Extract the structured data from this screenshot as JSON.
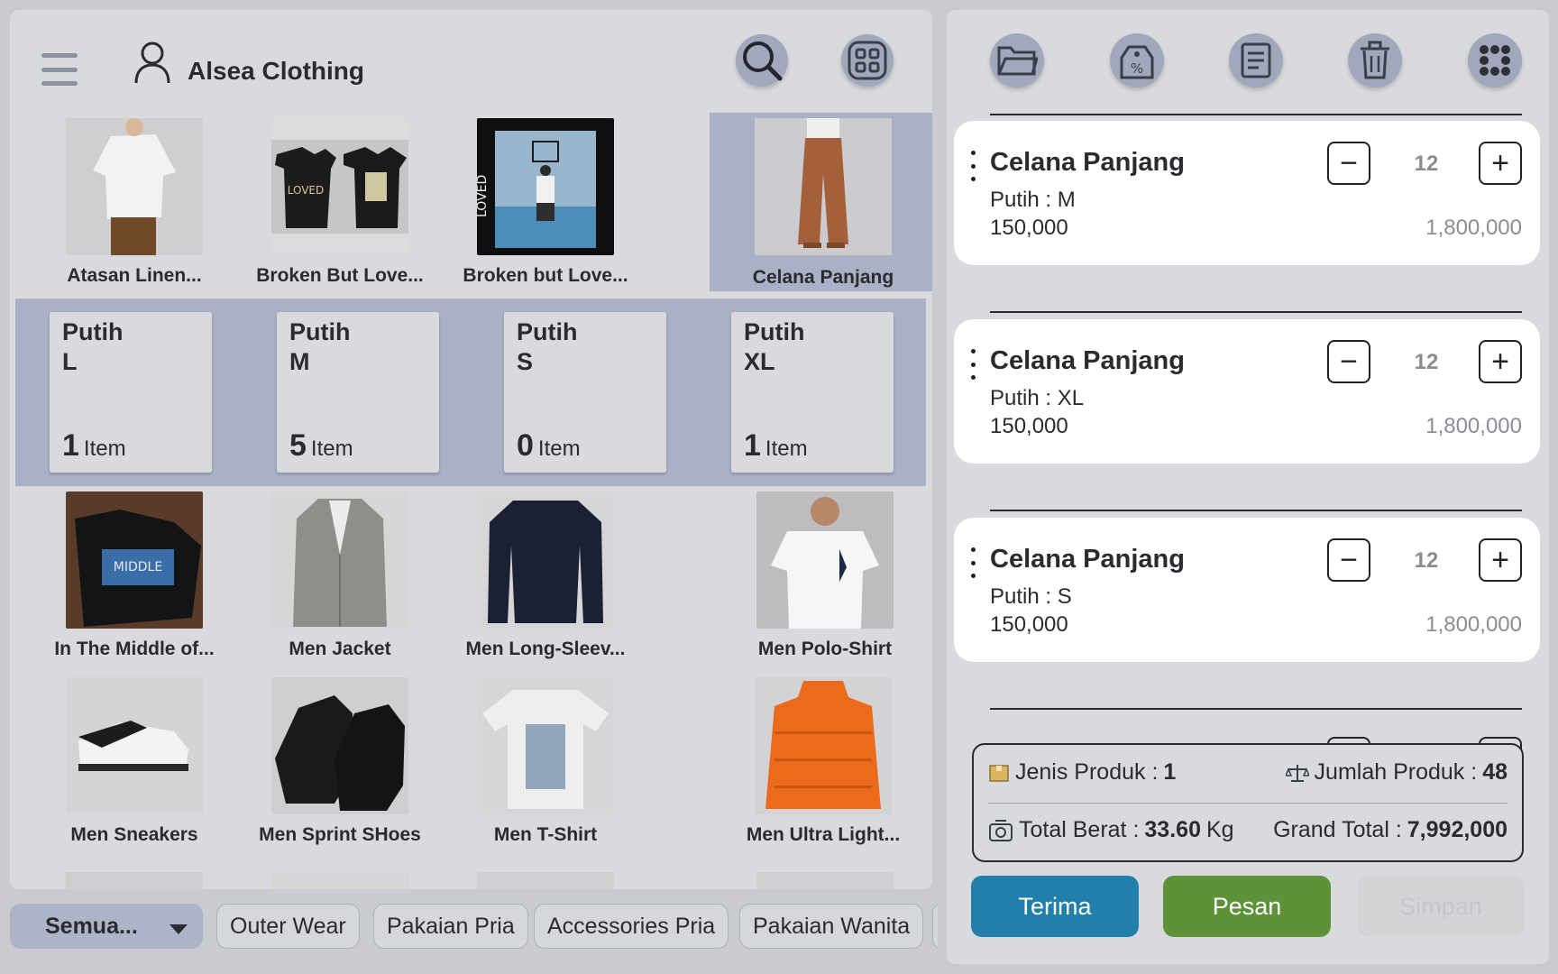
{
  "header": {
    "store_name": "Alsea Clothing"
  },
  "products": [
    {
      "name": "Atasan Linen..."
    },
    {
      "name": "Broken But Love..."
    },
    {
      "name": "Broken but Love..."
    },
    {
      "name": "Celana Panjang"
    },
    {
      "name": "In The Middle of..."
    },
    {
      "name": "Men Jacket"
    },
    {
      "name": "Men Long-Sleev..."
    },
    {
      "name": "Men Polo-Shirt"
    },
    {
      "name": "Men Sneakers"
    },
    {
      "name": "Men Sprint SHoes"
    },
    {
      "name": "Men T-Shirt"
    },
    {
      "name": "Men Ultra Light..."
    }
  ],
  "variants": [
    {
      "color": "Putih",
      "size": "L",
      "count": "1",
      "unit": "Item"
    },
    {
      "color": "Putih",
      "size": "M",
      "count": "5",
      "unit": "Item"
    },
    {
      "color": "Putih",
      "size": "S",
      "count": "0",
      "unit": "Item"
    },
    {
      "color": "Putih",
      "size": "XL",
      "count": "1",
      "unit": "Item"
    }
  ],
  "categories": [
    "Semua...",
    "Outer Wear",
    "Pakaian Pria",
    "Accessories Pria",
    "Pakaian Wanita"
  ],
  "cart": [
    {
      "title": "Celana Panjang",
      "variant": "Putih : M",
      "price": "150,000",
      "qty": "12",
      "subtotal": "1,800,000"
    },
    {
      "title": "Celana Panjang",
      "variant": "Putih : XL",
      "price": "150,000",
      "qty": "12",
      "subtotal": "1,800,000"
    },
    {
      "title": "Celana Panjang",
      "variant": "Putih : S",
      "price": "150,000",
      "qty": "12",
      "subtotal": "1,800,000"
    }
  ],
  "summary": {
    "jenis_label": "Jenis Produk :",
    "jenis_value": "1",
    "jumlah_label": "Jumlah Produk :",
    "jumlah_value": "48",
    "berat_label": "Total Berat :",
    "berat_value": "33.60",
    "berat_unit": "Kg",
    "grand_label": "Grand Total :",
    "grand_value": "7,992,000"
  },
  "actions": {
    "terima": "Terima",
    "pesan": "Pesan",
    "simpan": "Simpan"
  },
  "colors": {
    "accent_blue": "#217fa9",
    "accent_green": "#5e9238",
    "selected_bg": "#aab1c6"
  },
  "icons": [
    "menu-icon",
    "user-icon",
    "search-icon",
    "grid-icon",
    "folder-icon",
    "discount-tag-icon",
    "receipt-icon",
    "trash-icon",
    "dots-grid-icon",
    "package-icon",
    "scale-icon",
    "weight-icon"
  ]
}
